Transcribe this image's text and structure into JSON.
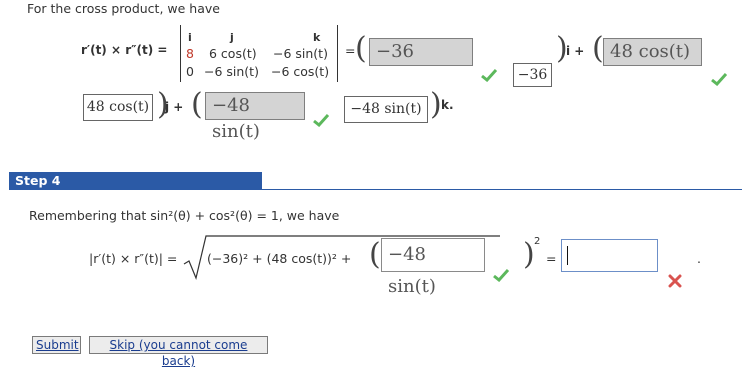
{
  "intro": {
    "text": "For the cross product, we have"
  },
  "cross": {
    "lhs": "r′(t) × r″(t) =",
    "det": {
      "headers": [
        "i",
        "j",
        "k"
      ],
      "row1": [
        "8",
        "6 cos(t)",
        "−6 sin(t)"
      ],
      "row2": [
        "0",
        "−6 sin(t)",
        "−6 cos(t)"
      ]
    },
    "equals": "=",
    "i_answer": "−36",
    "i_value": "−36",
    "i_unit": "i +",
    "j_answer": "48 cos(t)",
    "j_value": "48 cos(t)",
    "j_unit": "j +",
    "k_answer": "−48 sin(t)",
    "k_value": "−48 sin(t)",
    "k_unit": "k."
  },
  "step": {
    "label": "Step 4",
    "text_prefix": "Remembering that  sin²(θ) + cos²(θ) = 1,  we have",
    "lhs": "|r′(t) × r″(t)| =",
    "radicand_prefix": "(−36)² + (48 cos(t))² +",
    "answer": "−48 sin(t)",
    "exponent": "2",
    "equals": "=",
    "input_value": "",
    "trailing": "."
  },
  "buttons": {
    "submit": "Submit",
    "skip": "Skip (you cannot come back)"
  },
  "colors": {
    "correct": "#5cb85c",
    "incorrect": "#d9534f",
    "step_bar": "#2b5aa6"
  }
}
